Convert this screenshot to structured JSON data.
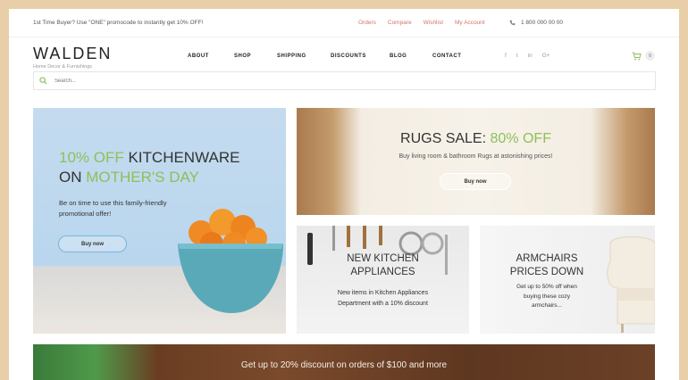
{
  "topbar": {
    "promo": "1st Time Buyer? Use \"ONE\" promocode to instantly get 10% OFF!",
    "links": [
      "Orders",
      "Compare",
      "Wishlist",
      "My Account"
    ],
    "phone": "1 800 000 00 00"
  },
  "header": {
    "logo_title": "WALDEN",
    "logo_subtitle": "Home Decor & Furnishings",
    "nav": [
      "ABOUT",
      "SHOP",
      "SHIPPING",
      "DISCOUNTS",
      "BLOG",
      "CONTACT"
    ],
    "social": [
      "f",
      "t",
      "in",
      "G+"
    ],
    "cart_count": "0"
  },
  "search": {
    "placeholder": "Search..."
  },
  "banners": {
    "kitchenware": {
      "title_line1_accent": "10% OFF",
      "title_line1_rest": " KITCHENWARE",
      "title_line2_prefix": "ON ",
      "title_line2_accent": "MOTHER'S DAY",
      "text": "Be on time to use this family-friendly promotional offer!",
      "button": "Buy now"
    },
    "rugs": {
      "title_prefix": "RUGS SALE: ",
      "title_accent": "80% OFF",
      "text": "Buy living room & bathroom Rugs at astonishing prices!",
      "button": "Buy now"
    },
    "appliances": {
      "title_line1": "NEW KITCHEN",
      "title_line2": "APPLIANCES",
      "text_line1": "New items in Kitchen Appliances",
      "text_line2": "Department with a 10% discount"
    },
    "armchairs": {
      "title_line1": "ARMCHAIRS",
      "title_line2": "PRICES DOWN",
      "text_line1": "Get up to 50% off when",
      "text_line2": "buying these cozy",
      "text_line3": "armchairs..."
    },
    "bottom": {
      "text": "Get up to 20% discount on orders of $100 and more"
    }
  },
  "colors": {
    "accent_green": "#8dc05a",
    "link_red": "#d4736a",
    "background": "#e8cfa9"
  },
  "icons": [
    "phone-icon",
    "search-icon",
    "cart-icon",
    "facebook-icon",
    "twitter-icon",
    "instagram-icon",
    "google-plus-icon"
  ]
}
